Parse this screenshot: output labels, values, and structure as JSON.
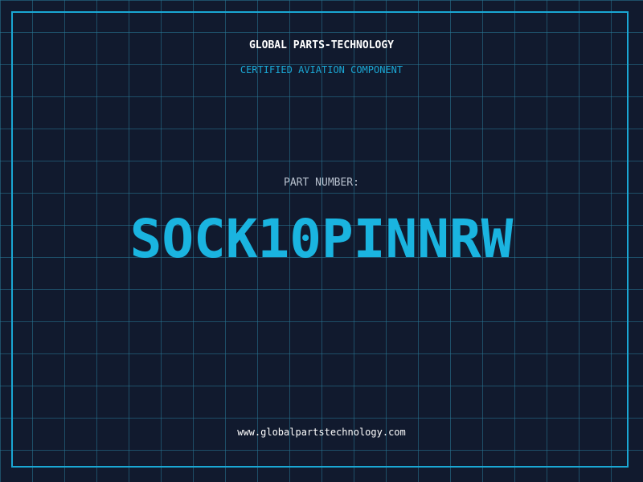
{
  "header": {
    "company": "GLOBAL PARTS-TECHNOLOGY",
    "subtitle": "CERTIFIED AVIATION COMPONENT"
  },
  "part": {
    "label": "PART NUMBER:",
    "number": "SOCK10PINNRW"
  },
  "footer": {
    "website": "www.globalpartstechnology.com"
  },
  "colors": {
    "background": "#111a2e",
    "grid": "#287896",
    "accent": "#1aa7d4",
    "text": "#ffffff",
    "muted": "#b9c2cf"
  }
}
